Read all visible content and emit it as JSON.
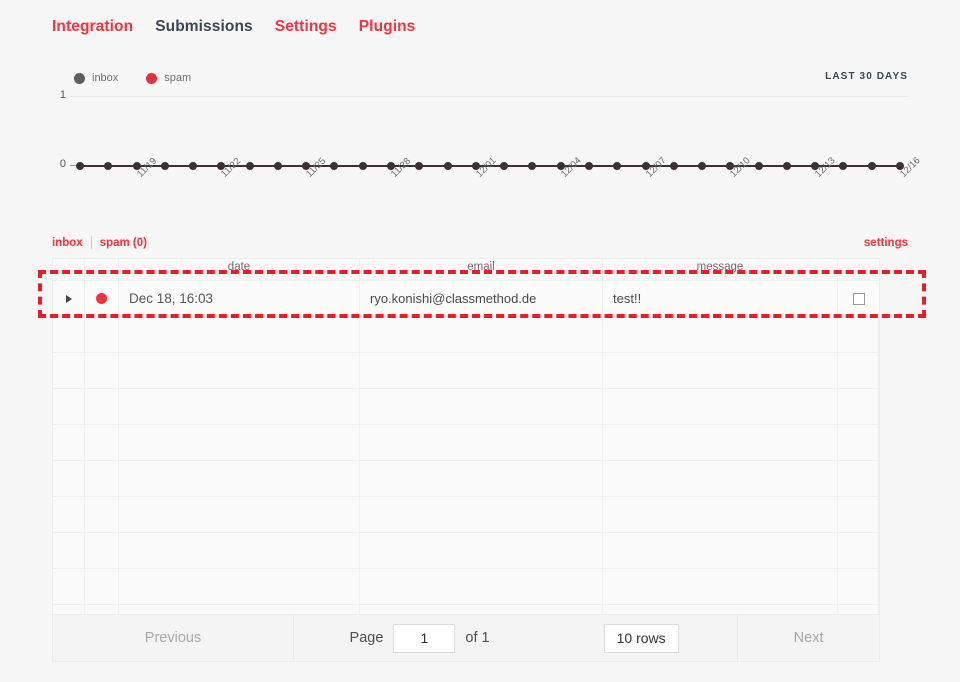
{
  "nav": {
    "items": [
      {
        "label": "Integration",
        "active": false
      },
      {
        "label": "Submissions",
        "active": true
      },
      {
        "label": "Settings",
        "active": false
      },
      {
        "label": "Plugins",
        "active": false
      }
    ]
  },
  "chart_panel": {
    "range_label": "LAST 30 DAYS"
  },
  "chart_data": {
    "type": "line",
    "title": "",
    "subtitle": "LAST 30 DAYS",
    "xlabel": "",
    "ylabel": "",
    "ylim": [
      0,
      1
    ],
    "yticks": [
      0,
      1
    ],
    "grid": true,
    "legend_position": "top-left",
    "x": [
      "11/17",
      "11/18",
      "11/19",
      "11/20",
      "11/21",
      "11/22",
      "11/23",
      "11/24",
      "11/25",
      "11/26",
      "11/27",
      "11/28",
      "11/29",
      "11/30",
      "12/01",
      "12/02",
      "12/03",
      "12/04",
      "12/05",
      "12/06",
      "12/07",
      "12/08",
      "12/09",
      "12/10",
      "12/11",
      "12/12",
      "12/13",
      "12/14",
      "12/15",
      "12/16"
    ],
    "xtick_labels": [
      "11/19",
      "11/22",
      "11/25",
      "11/28",
      "12/01",
      "12/04",
      "12/07",
      "12/10",
      "12/13",
      "12/16"
    ],
    "xtick_indices": [
      2,
      5,
      8,
      11,
      14,
      17,
      20,
      23,
      26,
      29
    ],
    "series": [
      {
        "name": "inbox",
        "color": "#5e5e5e",
        "values": [
          0,
          0,
          0,
          0,
          0,
          0,
          0,
          0,
          0,
          0,
          0,
          0,
          0,
          0,
          0,
          0,
          0,
          0,
          0,
          0,
          0,
          0,
          0,
          0,
          0,
          0,
          0,
          0,
          0,
          0
        ]
      },
      {
        "name": "spam",
        "color": "#e0313f",
        "values": [
          0,
          0,
          0,
          0,
          0,
          0,
          0,
          0,
          0,
          0,
          0,
          0,
          0,
          0,
          0,
          0,
          0,
          0,
          0,
          0,
          0,
          0,
          0,
          0,
          0,
          0,
          0,
          0,
          0,
          0
        ]
      }
    ]
  },
  "sub_tabs": {
    "inbox_label": "inbox",
    "spam_label": "spam (0)",
    "settings_label": "settings"
  },
  "table": {
    "columns": [
      "",
      "",
      "date",
      "email",
      "message",
      ""
    ],
    "headers": {
      "date": "date",
      "email": "email",
      "message": "message"
    },
    "rows": [
      {
        "date": "Dec 18, 16:03",
        "email": "ryo.konishi@classmethod.de",
        "message": "test!!",
        "status_color": "#f5333f",
        "selected": false
      }
    ],
    "empty_row_count": 9
  },
  "pagination": {
    "previous_label": "Previous",
    "page_label": "Page",
    "page_value": "1",
    "of_label": "of 1",
    "rows_per_page": "10 rows",
    "next_label": "Next"
  },
  "colors": {
    "accent_red": "#f5333f",
    "highlight_red": "#ec1c24",
    "nav_active": "#3a4654",
    "inbox_gray": "#5e5e5e",
    "spam_red": "#e0313f",
    "page_bg": "#f7f7f7"
  }
}
